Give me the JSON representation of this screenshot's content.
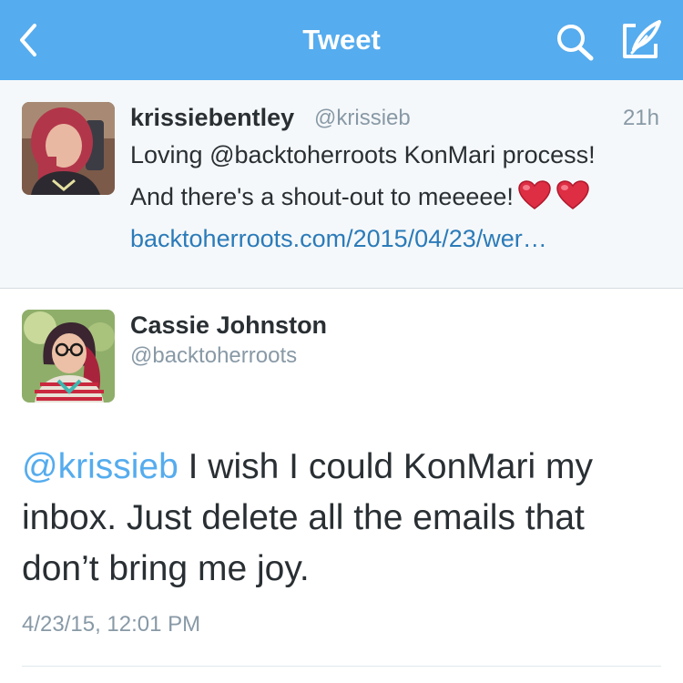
{
  "nav": {
    "title": "Tweet",
    "back_icon": "chevron-left-icon",
    "search_icon": "search-icon",
    "compose_icon": "compose-icon",
    "background": "#55acee"
  },
  "previous_tweet": {
    "name": "krissiebentley",
    "handle": "@krissieb",
    "time": "21h",
    "text_line1": "Loving @backtoherroots KonMari process!",
    "text_line2": "And there's a shout-out to meeeee!",
    "emoji": [
      "heart-icon",
      "heart-icon"
    ],
    "link": "backtoherroots.com/2015/04/23/wer…"
  },
  "main_tweet": {
    "name": "Cassie Johnston",
    "handle": "@backtoherroots",
    "mention": "@krissieb",
    "text": " I wish I could KonMari my inbox. Just delete all the emails that don’t bring me joy.",
    "date": "4/23/15, 12:01 PM"
  },
  "colors": {
    "link": "#2b7bb9",
    "mention": "#55acee",
    "muted": "#8899a6",
    "text": "#292f33"
  }
}
